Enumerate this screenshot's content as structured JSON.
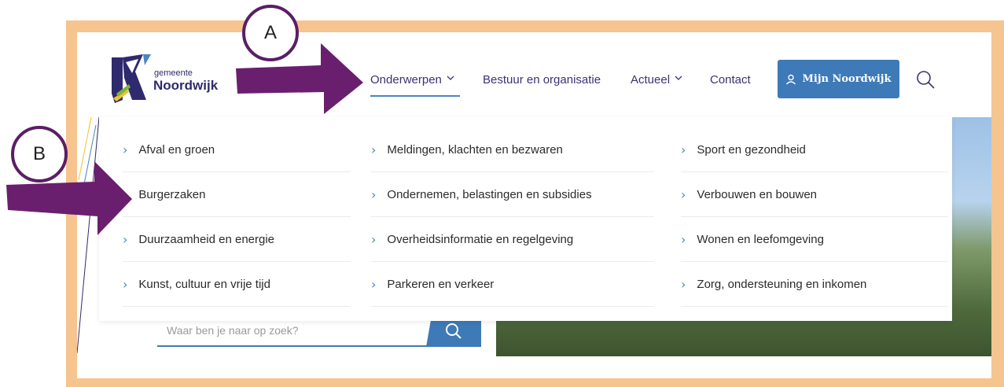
{
  "logo": {
    "line1": "gemeente",
    "line2": "Noordwijk"
  },
  "nav": {
    "items": [
      {
        "label": "Onderwerpen",
        "has_dropdown": true,
        "active": true
      },
      {
        "label": "Bestuur en organisatie",
        "has_dropdown": false
      },
      {
        "label": "Actueel",
        "has_dropdown": true
      },
      {
        "label": "Contact",
        "has_dropdown": false
      }
    ],
    "mijn_button": "Mijn Noordwijk"
  },
  "dropdown": {
    "columns": [
      [
        "Afval en groen",
        "Burgerzaken",
        "Duurzaamheid en energie",
        "Kunst, cultuur en vrije tijd"
      ],
      [
        "Meldingen, klachten en bezwaren",
        "Ondernemen, belastingen en subsidies",
        "Overheidsinformatie en regelgeving",
        "Parkeren en verkeer"
      ],
      [
        "Sport en gezondheid",
        "Verbouwen en bouwen",
        "Wonen en leefomgeving",
        "Zorg, ondersteuning en inkomen"
      ]
    ]
  },
  "search": {
    "placeholder": "Waar ben je naar op zoek?"
  },
  "annotations": {
    "a": "A",
    "b": "B"
  },
  "colors": {
    "frame": "#f5c48f",
    "brand_navy": "#2f2a6e",
    "brand_blue": "#3d7ab7",
    "annotation_purple": "#6a1f6e"
  }
}
